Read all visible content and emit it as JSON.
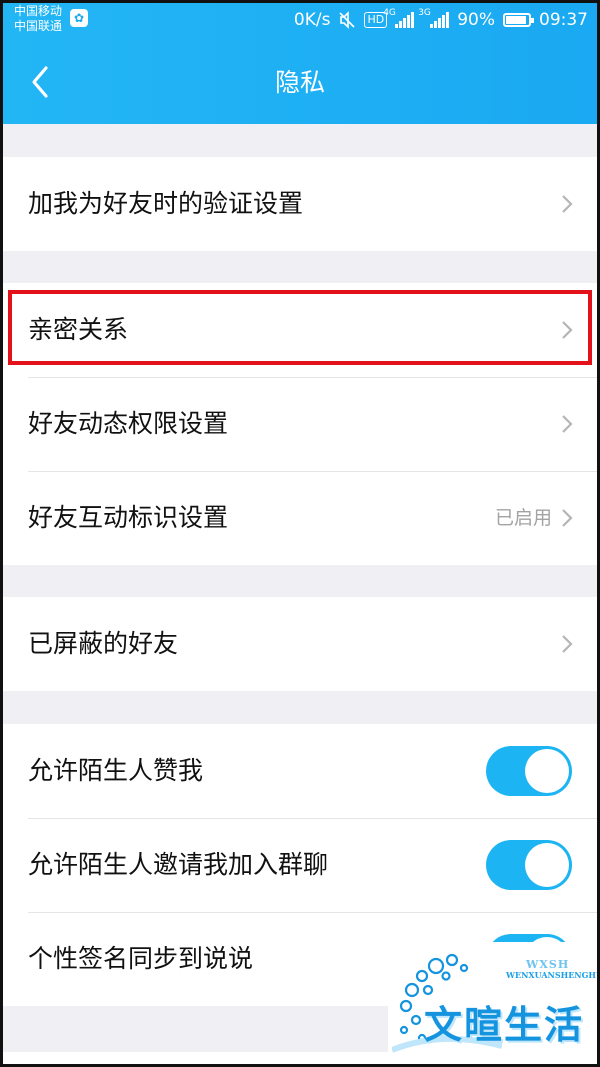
{
  "status_bar": {
    "carrier_1": "中国移动",
    "carrier_2": "中国联通",
    "speed": "0K/s",
    "hd": "HD",
    "net_1": "4G",
    "net_2": "3G",
    "battery": "90%",
    "battery_level": 0.9,
    "time": "09:37"
  },
  "header": {
    "title": "隐私",
    "back_icon": "chevron-left-icon"
  },
  "groups": [
    {
      "rows": [
        {
          "label": "加我为好友时的验证设置",
          "type": "link"
        }
      ]
    },
    {
      "rows": [
        {
          "label": "亲密关系",
          "type": "link",
          "highlighted": true
        },
        {
          "label": "好友动态权限设置",
          "type": "link"
        },
        {
          "label": "好友互动标识设置",
          "type": "link",
          "value": "已启用"
        }
      ]
    },
    {
      "rows": [
        {
          "label": "已屏蔽的好友",
          "type": "link"
        }
      ]
    },
    {
      "rows": [
        {
          "label": "允许陌生人赞我",
          "type": "toggle",
          "on": true
        },
        {
          "label": "允许陌生人邀请我加入群聊",
          "type": "toggle",
          "on": true
        },
        {
          "label": "个性签名同步到说说",
          "type": "toggle",
          "on": true
        }
      ]
    }
  ],
  "watermark": {
    "abbr": "WXSH",
    "english": "WENXUANSHENGHUO",
    "chinese": "文暄生活"
  },
  "colors": {
    "accent": "#1aa9f2",
    "highlight": "#e3121a",
    "toggle_on": "#1cb4f2",
    "chevron": "#b5b5b5"
  }
}
